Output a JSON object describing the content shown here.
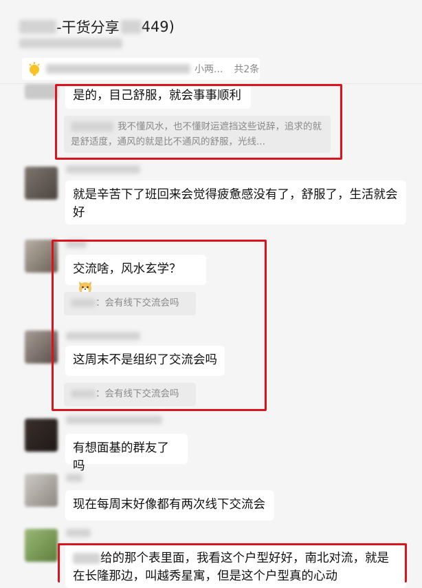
{
  "header": {
    "title_suffix": "-干货分享",
    "title_count": "449)",
    "pin_text": "小两...",
    "pin_count": "共2条"
  },
  "messages": [
    {
      "text": "是的，目己舒服，就会事事顺利",
      "quote": "我不懂风水，也不懂财运遮挡这些说辞，追求的就是舒适度，通风的就是比不通风的舒服，光线..."
    },
    {
      "text": "就是辛苦下了班回来会觉得疲惫感没有了，舒服了，生活就会好"
    },
    {
      "text": "交流啥，风水玄学？",
      "quote": "：会有线下交流会吗",
      "emoji": "cat-face-emoji"
    },
    {
      "text": "这周末不是组织了交流会吗",
      "quote": "：会有线下交流会吗"
    },
    {
      "text": "有想面基的群友了吗"
    },
    {
      "text": "现在每周末好像都有两次线下交流会"
    },
    {
      "text": "给的那个表里面，我看这个户型好好，南北对流，就是在长隆那边，叫越秀星寓，但是这个户型真的心动"
    }
  ],
  "colors": {
    "highlight_box": "#d9141d",
    "bubble": "#ffffff",
    "quote_bg": "#ebebeb",
    "background": "#f5f5f5"
  }
}
